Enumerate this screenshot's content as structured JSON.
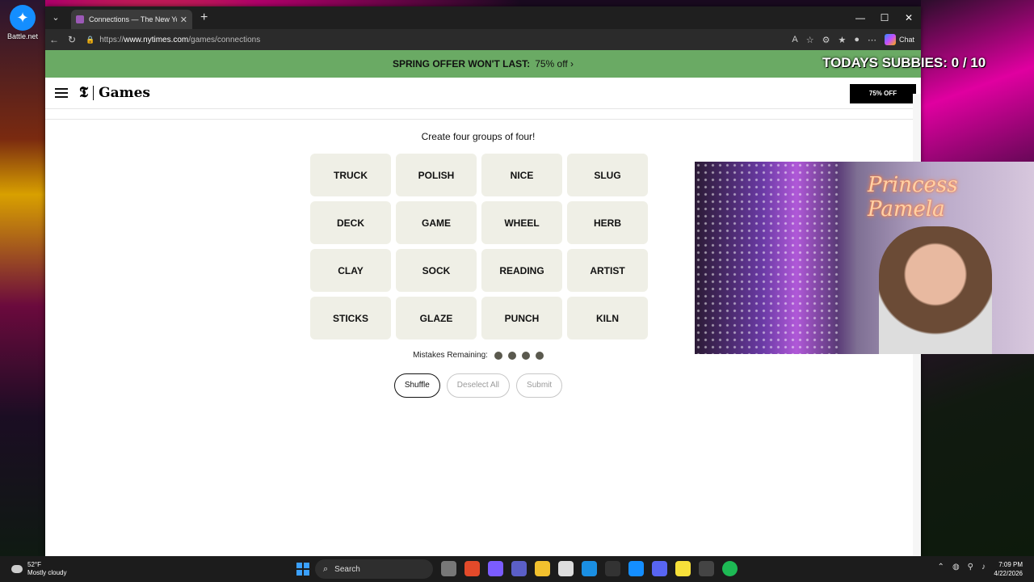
{
  "desktop": {
    "icon_label": "Battle.net"
  },
  "browser": {
    "tab_title": "Connections — The New York Tim",
    "tab_close": "✕",
    "new_tab": "+",
    "url_prefix": "https://",
    "url_host": "www.nytimes.com",
    "url_path": "/games/connections",
    "chat_label": "Chat",
    "window_controls": [
      "—",
      "☐",
      "✕"
    ]
  },
  "promo": {
    "text": "SPRING OFFER WON'T LAST:",
    "offer": "75% off ›"
  },
  "header": {
    "logo_t": "𝕿",
    "logo_text": "Games",
    "offer_button": "75% OFF"
  },
  "game": {
    "instructions": "Create four groups of four!",
    "words": [
      "TRUCK",
      "POLISH",
      "NICE",
      "SLUG",
      "DECK",
      "GAME",
      "WHEEL",
      "HERB",
      "CLAY",
      "SOCK",
      "READING",
      "ARTIST",
      "STICKS",
      "GLAZE",
      "PUNCH",
      "KILN"
    ],
    "mistakes_label": "Mistakes Remaining:",
    "mistakes_remaining": 4,
    "shuffle": "Shuffle",
    "deselect": "Deselect All",
    "submit": "Submit"
  },
  "overlay": {
    "subbies_text": "TODAYS SUBBIES:  0 / 10",
    "streamer_name": "Princess Pamela"
  },
  "taskbar": {
    "weather_temp": "52°F",
    "weather_desc": "Mostly cloudy",
    "search": "Search",
    "time": "7:09 PM",
    "date": "4/22/2026"
  },
  "colors": {
    "promo_bg": "#6aaa64",
    "card_bg": "#efefe6",
    "dot": "#5a594e"
  }
}
